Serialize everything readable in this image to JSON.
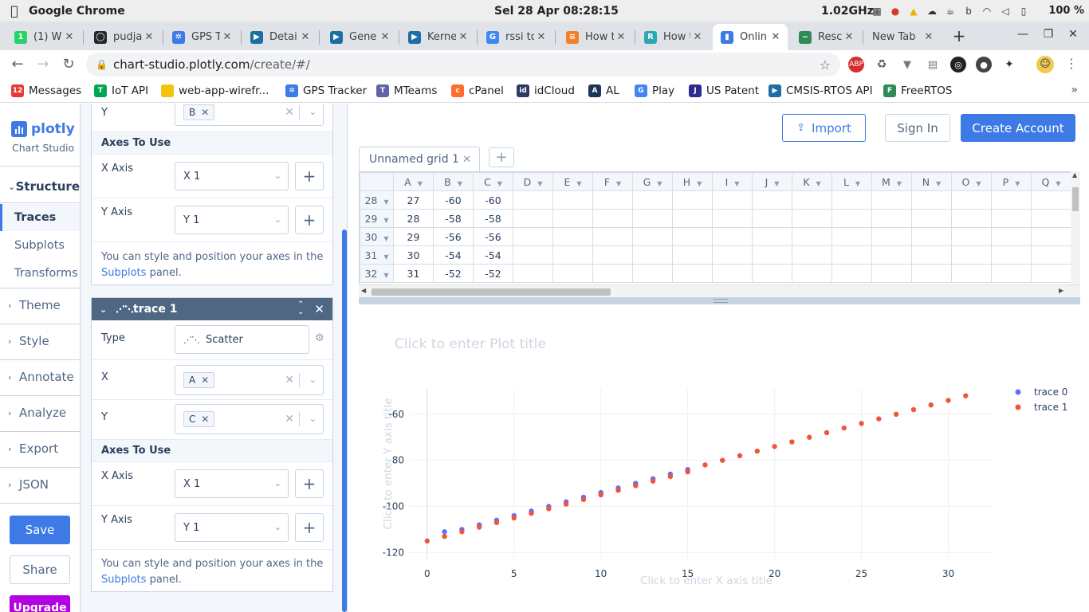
{
  "os": {
    "app": "Google Chrome",
    "clock": "Sel 28 Apr  08:28:15",
    "cpu": "1.02GHz",
    "battery": "100 %"
  },
  "tabs": [
    {
      "title": "(1) W",
      "color": "#25d366",
      "glyph": "1"
    },
    {
      "title": "pudja",
      "color": "#24292e",
      "glyph": "◯"
    },
    {
      "title": "GPS T",
      "color": "#3d7ae6",
      "glyph": "✲"
    },
    {
      "title": "Detai",
      "color": "#1c6ea4",
      "glyph": "▶"
    },
    {
      "title": "Gene",
      "color": "#1c6ea4",
      "glyph": "▶"
    },
    {
      "title": "Kerne",
      "color": "#1c6ea4",
      "glyph": "▶"
    },
    {
      "title": "rssi to",
      "color": "#4285f4",
      "glyph": "G"
    },
    {
      "title": "How t",
      "color": "#f48024",
      "glyph": "≡"
    },
    {
      "title": "How t",
      "color": "#2aa8b4",
      "glyph": "R"
    },
    {
      "title": "Onlin",
      "color": "#3d7ae6",
      "glyph": "▮",
      "active": true
    },
    {
      "title": "Resca",
      "color": "#2e8b57",
      "glyph": "~"
    },
    {
      "title": "New Tab",
      "color": "",
      "glyph": ""
    }
  ],
  "address": {
    "host": "chart-studio.plotly.com",
    "path": "/create/#/"
  },
  "bookmarks": [
    {
      "label": "Messages",
      "color": "#e53935",
      "glyph": "12"
    },
    {
      "label": "IoT API",
      "color": "#00a651",
      "glyph": "T"
    },
    {
      "label": "web-app-wirefr...",
      "color": "#f4c20d",
      "glyph": ""
    },
    {
      "label": "GPS Tracker",
      "color": "#3d7ae6",
      "glyph": "✲"
    },
    {
      "label": "MTeams",
      "color": "#6264a7",
      "glyph": "T"
    },
    {
      "label": "cPanel",
      "color": "#ff6c2c",
      "glyph": "c"
    },
    {
      "label": "idCloud",
      "color": "#2b3a67",
      "glyph": "id"
    },
    {
      "label": "AL",
      "color": "#1d3557",
      "glyph": "A"
    },
    {
      "label": "Play",
      "color": "#4285f4",
      "glyph": "G"
    },
    {
      "label": "US Patent",
      "color": "#2c2c8c",
      "glyph": "J"
    },
    {
      "label": "CMSIS-RTOS API",
      "color": "#1c6ea4",
      "glyph": "▶"
    },
    {
      "label": "FreeRTOS",
      "color": "#2e8b57",
      "glyph": "F"
    }
  ],
  "nav": {
    "logo": "plotly",
    "logo_sub": "Chart Studio",
    "structure": "Structure",
    "traces": "Traces",
    "subplots": "Subplots",
    "transforms": "Transforms",
    "theme": "Theme",
    "style": "Style",
    "annotate": "Annotate",
    "analyze": "Analyze",
    "export": "Export",
    "json": "JSON",
    "save": "Save",
    "share": "Share",
    "upgrade": "Upgrade"
  },
  "panel": {
    "trace0": {
      "y_label": "Y",
      "y_value": "B",
      "axes_heading": "Axes To Use",
      "x_axis_label": "X Axis",
      "x_axis_value": "X 1",
      "y_axis_label": "Y Axis",
      "y_axis_value": "Y 1",
      "info_pre": "You can style and position your axes in the",
      "info_link": "Subplots",
      "info_post": "panel."
    },
    "trace1": {
      "name": "trace 1",
      "type_label": "Type",
      "type_value": "Scatter",
      "x_label": "X",
      "x_value": "A",
      "y_label": "Y",
      "y_value": "C",
      "axes_heading": "Axes To Use",
      "x_axis_label": "X Axis",
      "x_axis_value": "X 1",
      "y_axis_label": "Y Axis",
      "y_axis_value": "Y 1",
      "info_pre": "You can style and position your axes in the",
      "info_link": "Subplots",
      "info_post": "panel."
    }
  },
  "header": {
    "import": "Import",
    "sign_in": "Sign In",
    "create_account": "Create Account"
  },
  "grid": {
    "tab_name": "Unnamed grid 1",
    "columns": [
      "A",
      "B",
      "C",
      "D",
      "E",
      "F",
      "G",
      "H",
      "I",
      "J",
      "K",
      "L",
      "M",
      "N",
      "O",
      "P",
      "Q"
    ],
    "rows": [
      {
        "n": "28",
        "cells": [
          "27",
          "-60",
          "-60"
        ]
      },
      {
        "n": "29",
        "cells": [
          "28",
          "-58",
          "-58"
        ]
      },
      {
        "n": "30",
        "cells": [
          "29",
          "-56",
          "-56"
        ]
      },
      {
        "n": "31",
        "cells": [
          "30",
          "-54",
          "-54"
        ]
      },
      {
        "n": "32",
        "cells": [
          "31",
          "-52",
          "-52"
        ]
      }
    ]
  },
  "plot": {
    "title_placeholder": "Click to enter Plot title",
    "x_placeholder": "Click to enter X axis title",
    "y_placeholder": "Click to enter Y axis title"
  },
  "chart_data": {
    "type": "scatter",
    "xlim": [
      -1,
      32.5
    ],
    "ylim": [
      -123,
      -49
    ],
    "x_ticks": [
      0,
      5,
      10,
      15,
      20,
      25,
      30
    ],
    "y_ticks": [
      -120,
      -100,
      -80,
      -60
    ],
    "legend_position": "top-right",
    "series": [
      {
        "name": "trace 0",
        "color": "#636efa",
        "x": [
          1,
          2,
          3,
          4,
          5,
          6,
          7,
          8,
          9,
          10,
          11,
          12,
          13,
          14,
          15
        ],
        "y": [
          -111,
          -110,
          -108,
          -106,
          -104,
          -102,
          -100,
          -98,
          -96,
          -94,
          -92,
          -90,
          -88,
          -86,
          -84
        ]
      },
      {
        "name": "trace 1",
        "color": "#ef553b",
        "x": [
          0,
          1,
          2,
          3,
          4,
          5,
          6,
          7,
          8,
          9,
          10,
          11,
          12,
          13,
          14,
          15,
          16,
          17,
          18,
          19,
          20,
          21,
          22,
          23,
          24,
          25,
          26,
          27,
          28,
          29,
          30,
          31
        ],
        "y": [
          -115,
          -113,
          -111,
          -109,
          -107,
          -105,
          -103,
          -101,
          -99,
          -97,
          -95,
          -93,
          -91,
          -89,
          -87,
          -85,
          -82,
          -80,
          -78,
          -76,
          -74,
          -72,
          -70,
          -68,
          -66,
          -64,
          -62,
          -60,
          -58,
          -56,
          -54,
          -52
        ]
      }
    ]
  }
}
